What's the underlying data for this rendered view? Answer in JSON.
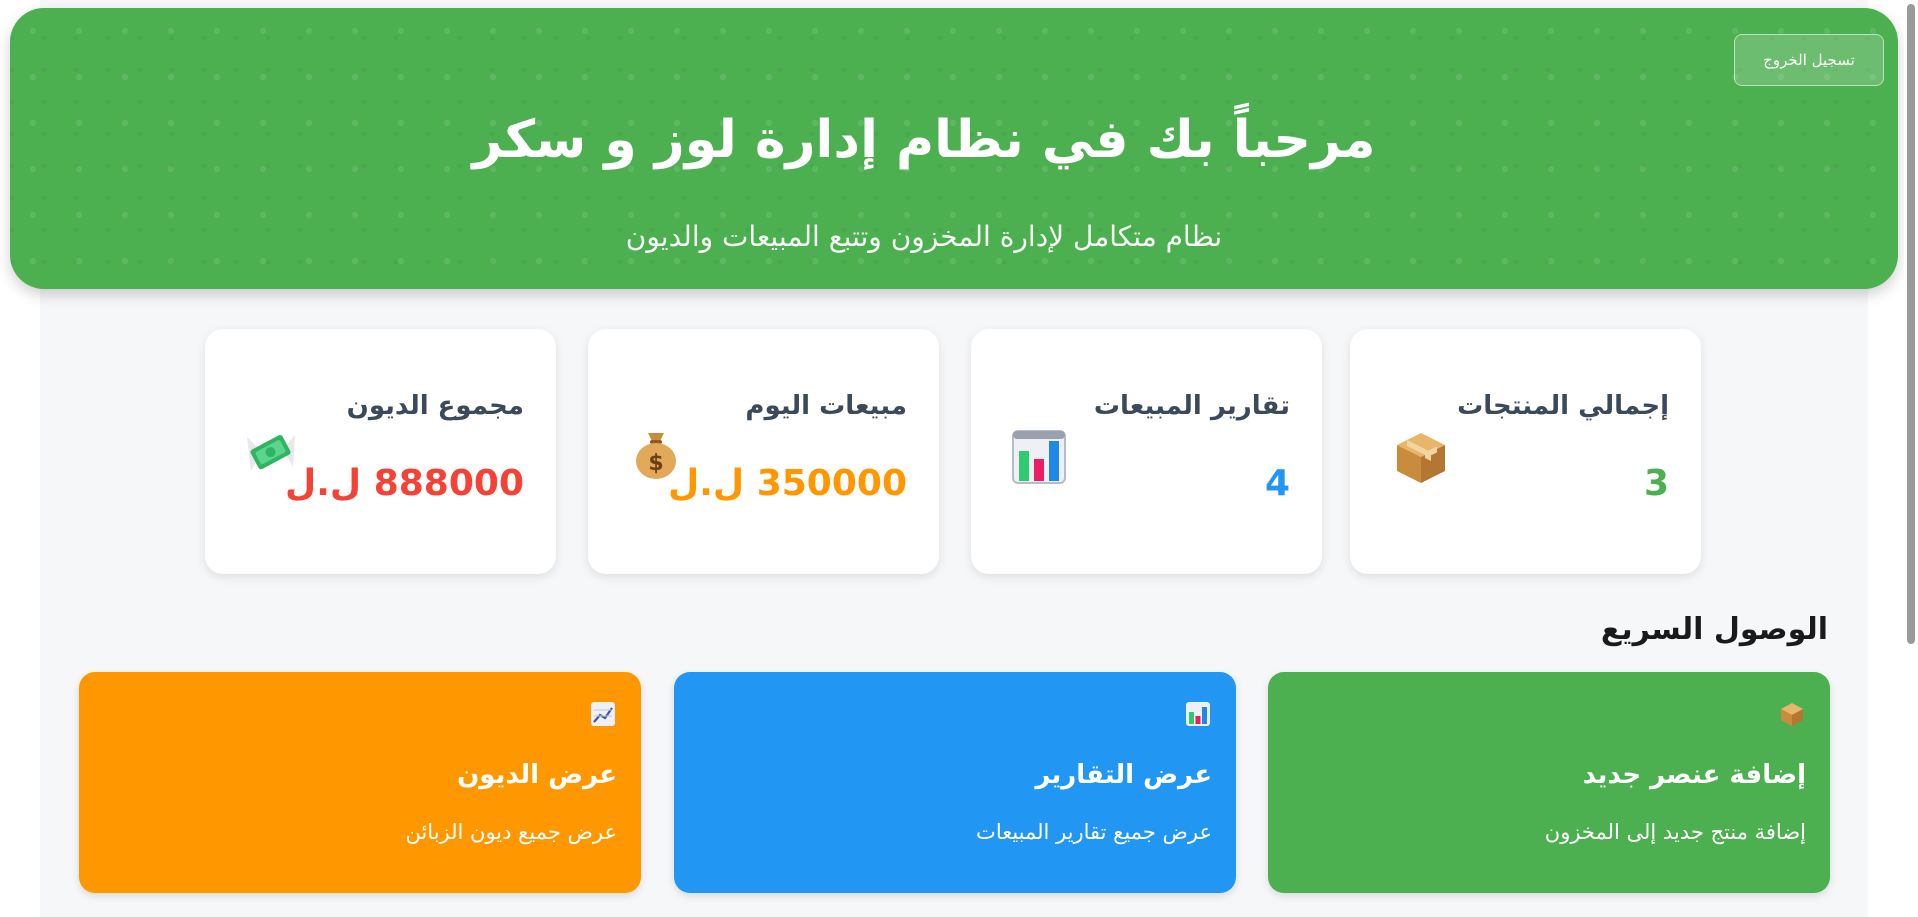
{
  "header": {
    "logout_label": "تسجيل الخروج",
    "title": "مرحباً بك في نظام إدارة لوز و سكر",
    "subtitle": "نظام متكامل لإدارة المخزون وتتبع المبيعات والديون"
  },
  "stats": [
    {
      "label": "إجمالي المنتجات",
      "value": "3",
      "color": "#4caf50",
      "icon": "package-icon"
    },
    {
      "label": "تقارير المبيعات",
      "value": "4",
      "color": "#2196f3",
      "icon": "bar-chart-icon"
    },
    {
      "label": "مبيعات اليوم",
      "value": "350000 ل.ل",
      "color": "#ff9800",
      "icon": "money-bag-icon"
    },
    {
      "label": "مجموع الديون",
      "value": "888000 ل.ل",
      "color": "#f44336",
      "icon": "money-wings-icon"
    }
  ],
  "quick_access": {
    "title": "الوصول السريع",
    "items": [
      {
        "title": "إضافة عنصر جديد",
        "desc": "إضافة منتج جديد إلى المخزون",
        "color": "#4caf50",
        "icon": "package-icon"
      },
      {
        "title": "عرض التقارير",
        "desc": "عرض جميع تقارير المبيعات",
        "color": "#2196f3",
        "icon": "bar-chart-icon"
      },
      {
        "title": "عرض الديون",
        "desc": "عرض جميع ديون الزبائن",
        "color": "#ff9800",
        "icon": "trend-chart-icon"
      }
    ]
  }
}
